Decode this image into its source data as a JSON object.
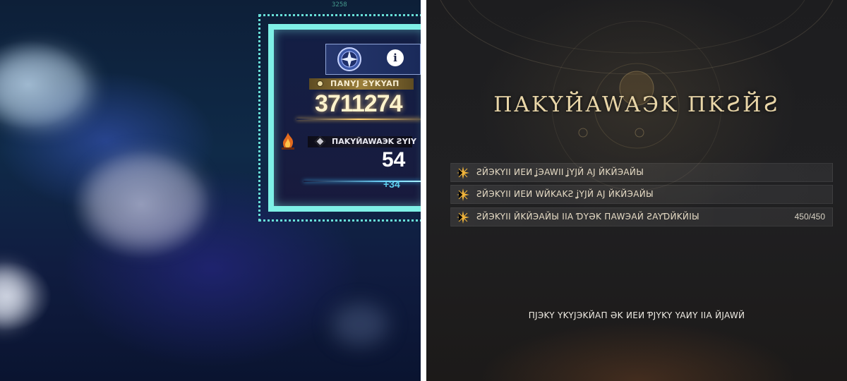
{
  "left_panel": {
    "top_indicator": "3258",
    "score_label": "ПANYJ ƧYKYAП",
    "score_value": "3711274",
    "cultivation_label": "ПAKYЙAWAЭK ƧYIY",
    "cultivation_value": "54",
    "cultivation_delta": "+34",
    "info_icon_glyph": "i",
    "accent_colors": {
      "frame": "#7ef0e6",
      "gold": "#ffd070",
      "delta": "#5fd0f0"
    }
  },
  "right_panel": {
    "title": "ПAKYЙAWAЭK ПKƧЙƧ",
    "tasks": [
      {
        "text": "ƧЙЭKYII ИEИ ʝЭAWII ʝYJЙ AJ ЙKЙЭAЙЫ",
        "progress": ""
      },
      {
        "text": "ƧЙЭKYII ИEИ WЙKAKƧ ʝYJЙ AJ ЙKЙЭAЙЫ",
        "progress": ""
      },
      {
        "text": "ƧЙЭKYII ЙKЙЭAЙЫ IIA ƊYƏK ПAWЭAЙ ƧAYƊЙKЙIЫ",
        "progress": "450/450"
      }
    ],
    "footer": "ПJЭKY YKYJЭKЙAП ƏK ИEИ ƤJYKY YAИY IIA ЙJAWЙ"
  }
}
